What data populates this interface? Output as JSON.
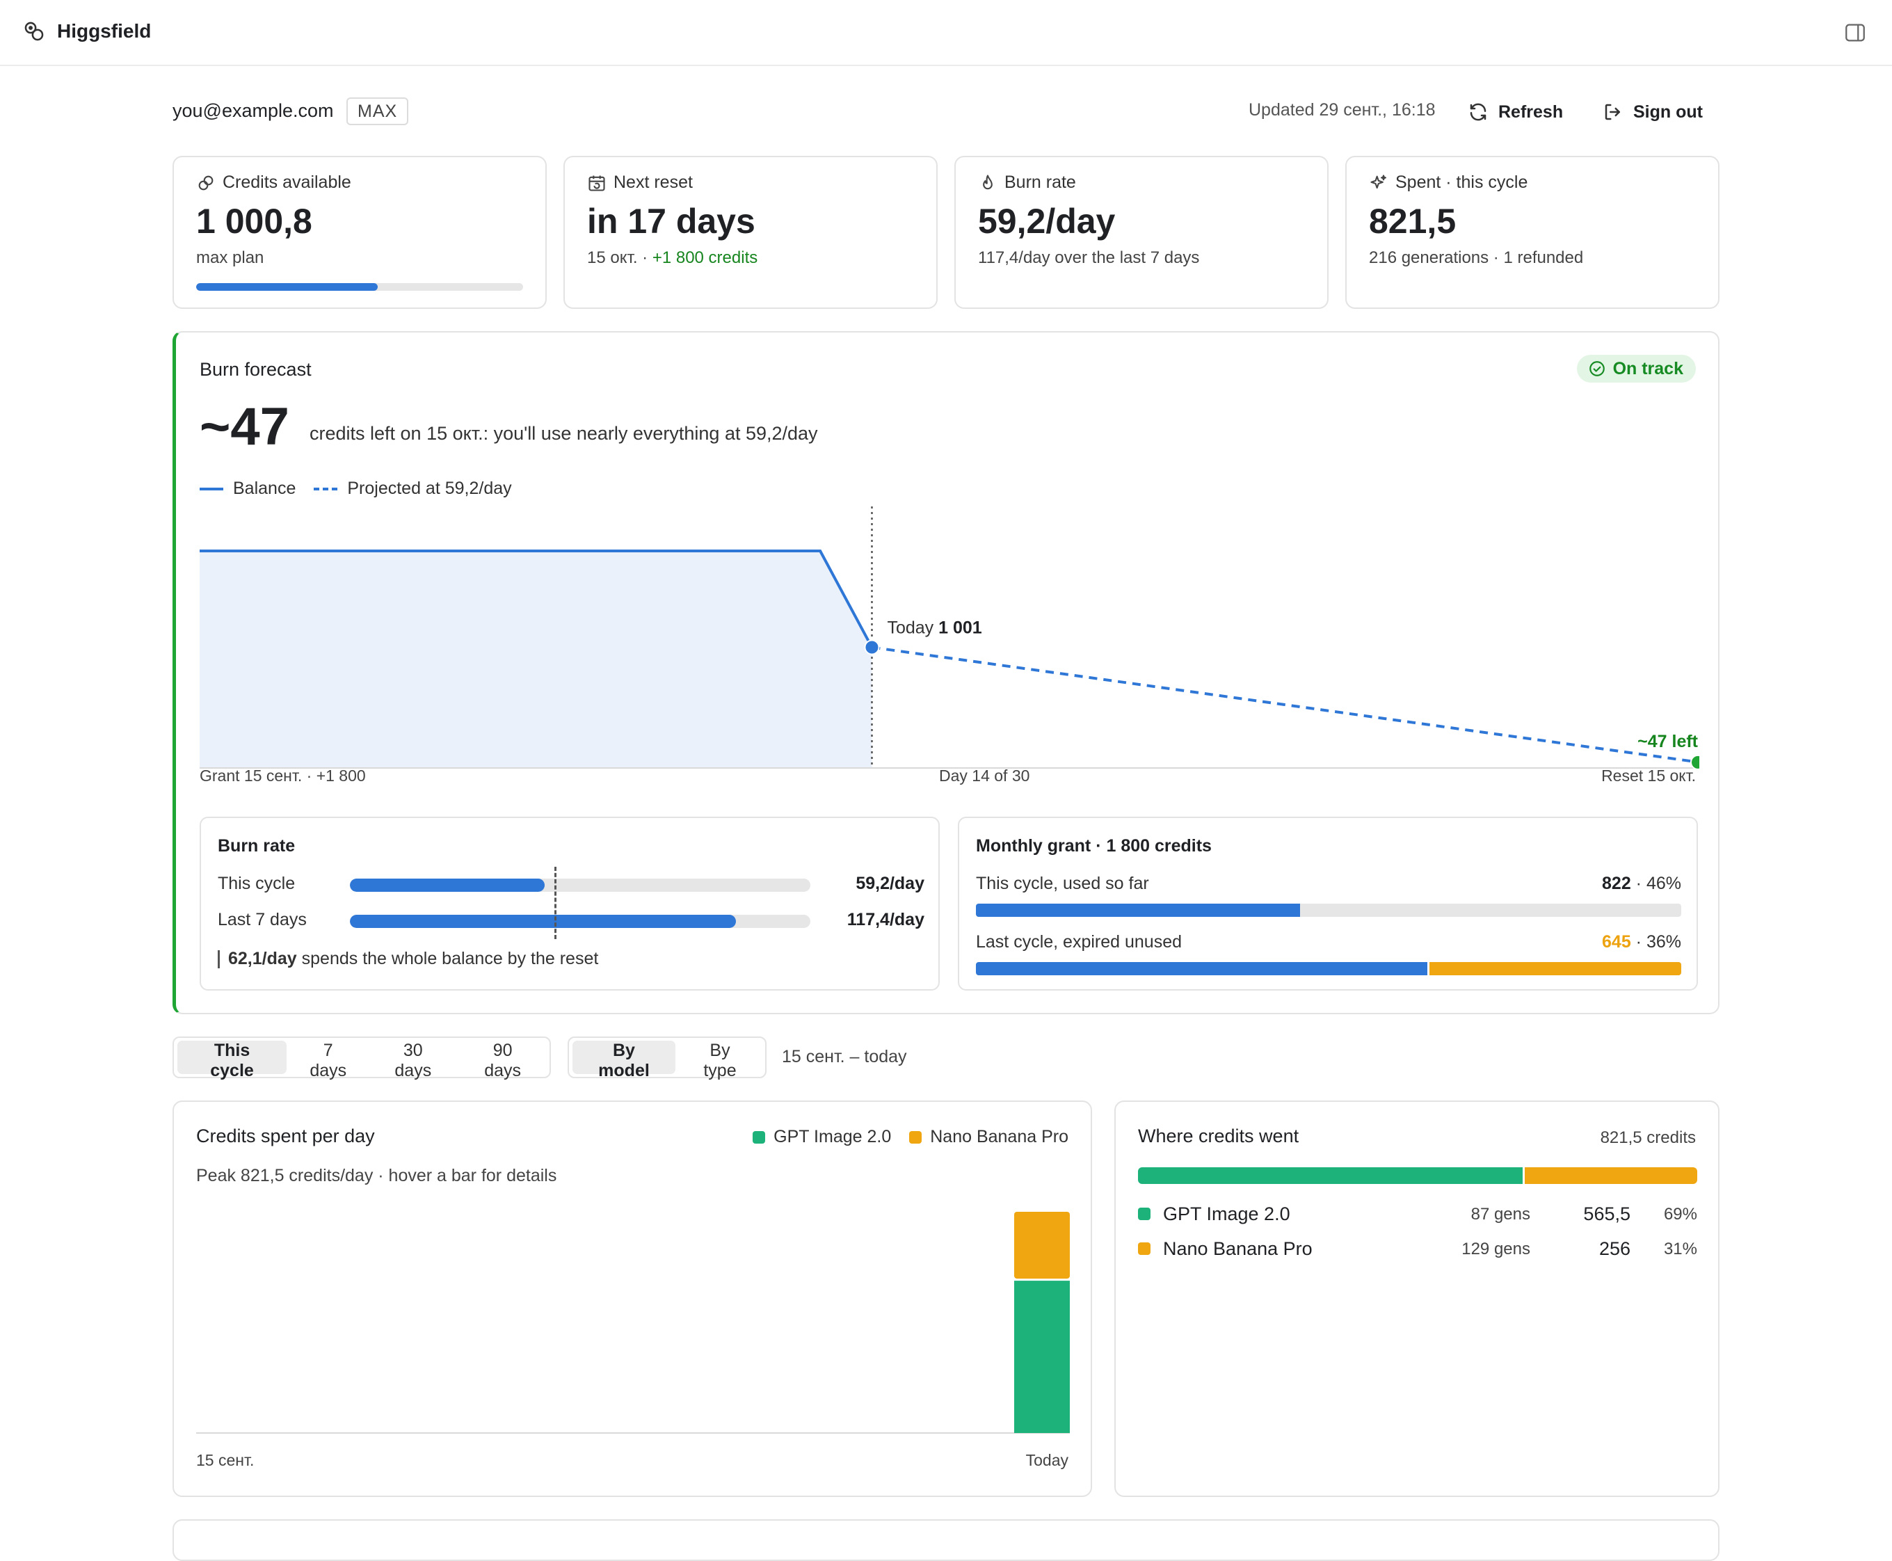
{
  "app": {
    "name": "Higgsfield"
  },
  "account": {
    "email": "you@example.com",
    "plan_badge": "MAX",
    "updated": "Updated 29 сент., 16:18",
    "refresh_label": "Refresh",
    "signout_label": "Sign out"
  },
  "stats": {
    "credits": {
      "label": "Credits available",
      "value": "1 000,8",
      "sub": "max plan",
      "fill_fraction": 0.556
    },
    "reset": {
      "label": "Next reset",
      "value": "in 17 days",
      "sub_prefix": "15 окт. · ",
      "sub_green": "+1 800 credits"
    },
    "burn": {
      "label": "Burn rate",
      "value": "59,2/day",
      "sub": "117,4/day over the last 7 days"
    },
    "spent": {
      "label": "Spent · this cycle",
      "value": "821,5",
      "sub": "216 generations · 1 refunded"
    }
  },
  "forecast": {
    "title": "Burn forecast",
    "status": "On track",
    "big": "~47",
    "text": "credits left on 15 окт.: you'll use nearly everything at 59,2/day",
    "legend_balance": "Balance",
    "legend_projected": "Projected at 59,2/day",
    "today_label": "Today",
    "today_value": "1 001",
    "end_label": "~47 left",
    "axis_left": "Grant 15 сент. · +1 800",
    "axis_center": "Day 14 of 30",
    "axis_right": "Reset 15 окт.",
    "colors": {
      "balance": "#2f77d6",
      "area": "#eaf1fb",
      "end_point": "#1fa534"
    }
  },
  "burn_rate": {
    "title": "Burn rate",
    "rows": [
      {
        "label": "This cycle",
        "value": "59,2/day",
        "rate": 59.2
      },
      {
        "label": "Last 7 days",
        "value": "117,4/day",
        "rate": 117.4
      }
    ],
    "target_value": "62,1/day",
    "target_text": "spends the whole balance by the reset"
  },
  "monthly_grant": {
    "title": "Monthly grant · 1 800 credits",
    "this_cycle_label": "This cycle, used so far",
    "this_cycle_amount": "822",
    "this_cycle_pct": " · 46%",
    "this_cycle_fraction": 0.46,
    "last_cycle_label": "Last cycle, expired unused",
    "last_cycle_amount": "645",
    "last_cycle_pct": " · 36%",
    "last_cycle_expired_fraction": 0.36
  },
  "filters": {
    "periods": [
      "This cycle",
      "7 days",
      "30 days",
      "90 days"
    ],
    "period_active": 0,
    "groupings": [
      "By model",
      "By type"
    ],
    "grouping_active": 0,
    "range": "15 сент. – today"
  },
  "daily": {
    "title": "Credits spent per day",
    "subtitle": "Peak 821,5 credits/day · hover a bar for details",
    "x_start": "15 сент.",
    "x_end": "Today"
  },
  "where": {
    "title": "Where credits went",
    "total": "821,5 credits",
    "rows": [
      {
        "name": "GPT Image 2.0",
        "gens": "87 gens",
        "credits": "565,5",
        "pct": "69%"
      },
      {
        "name": "Nano Banana Pro",
        "gens": "129 gens",
        "credits": "256",
        "pct": "31%"
      }
    ]
  },
  "models": {
    "colors": [
      "#1db27a",
      "#f0a610"
    ]
  },
  "chart_data": [
    {
      "type": "line",
      "title": "Burn forecast",
      "x": [
        1,
        13,
        14,
        30
      ],
      "series": [
        {
          "name": "Balance",
          "values": [
            1800,
            1800,
            1000.8,
            null
          ]
        },
        {
          "name": "Projected at 59,2/day",
          "values": [
            null,
            null,
            1000.8,
            47
          ]
        }
      ],
      "xlim": [
        1,
        30
      ],
      "ylim": [
        0,
        2000
      ],
      "grid": false,
      "legend": "top-left"
    },
    {
      "type": "bar",
      "title": "Credits spent per day",
      "categories": [
        "15 сент.",
        "Today"
      ],
      "series": [
        {
          "name": "GPT Image 2.0",
          "values": [
            0,
            565.5
          ]
        },
        {
          "name": "Nano Banana Pro",
          "values": [
            0,
            256
          ]
        }
      ],
      "ylim": [
        0,
        821.5
      ],
      "stacked": true,
      "legend": "top-right"
    }
  ]
}
